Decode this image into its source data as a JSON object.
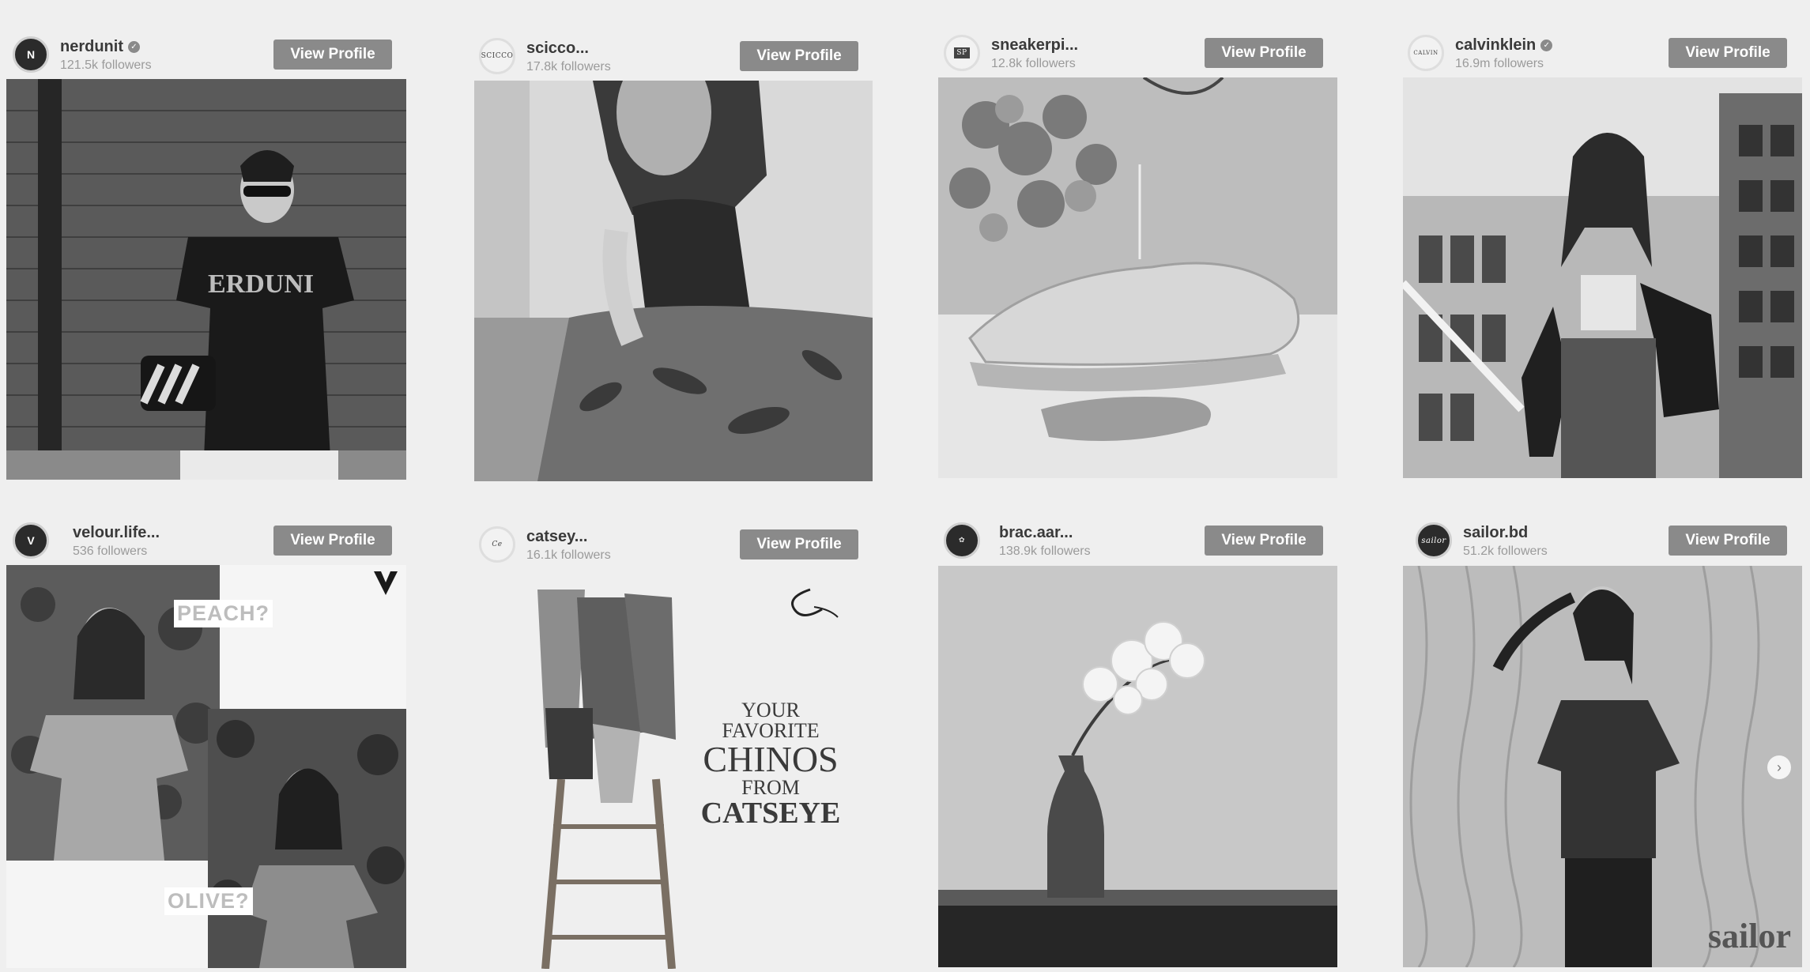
{
  "cards": [
    {
      "username": "nerdunit",
      "followers": "121.5k followers",
      "verified": true,
      "button": "View Profile",
      "avatar_icon": "nerdunit-logo-icon"
    },
    {
      "username": "scicco...",
      "followers": "17.8k followers",
      "verified": false,
      "button": "View Profile",
      "avatar_icon": "scicco-logo-icon"
    },
    {
      "username": "sneakerpi...",
      "followers": "12.8k followers",
      "verified": false,
      "button": "View Profile",
      "avatar_icon": "sneakerpi-logo-icon"
    },
    {
      "username": "calvinklein",
      "followers": "16.9m followers",
      "verified": true,
      "button": "View Profile",
      "avatar_icon": "calvinklein-logo-icon"
    },
    {
      "username": "velour.life...",
      "followers": "536 followers",
      "verified": false,
      "button": "View Profile",
      "avatar_icon": "velour-logo-icon"
    },
    {
      "username": "catsey...",
      "followers": "16.1k followers",
      "verified": false,
      "button": "View Profile",
      "avatar_icon": "catseye-logo-icon"
    },
    {
      "username": "brac.aar...",
      "followers": "138.9k followers",
      "verified": false,
      "button": "View Profile",
      "avatar_icon": "brac-logo-icon"
    },
    {
      "username": "sailor.bd",
      "followers": "51.2k followers",
      "verified": false,
      "button": "View Profile",
      "avatar_icon": "sailor-logo-icon"
    }
  ],
  "overlays": {
    "velour_peach": "PEACH?",
    "velour_olive": "OLIVE?",
    "catseye_line1": "YOUR",
    "catseye_line2": "FAVORITE",
    "catseye_line3": "CHINOS",
    "catseye_line4": "FROM",
    "catseye_line5": "CATSEYE",
    "sailor_brand": "sailor"
  },
  "icons": {
    "verified": "verified-badge-icon",
    "next": "chevron-right-icon"
  }
}
